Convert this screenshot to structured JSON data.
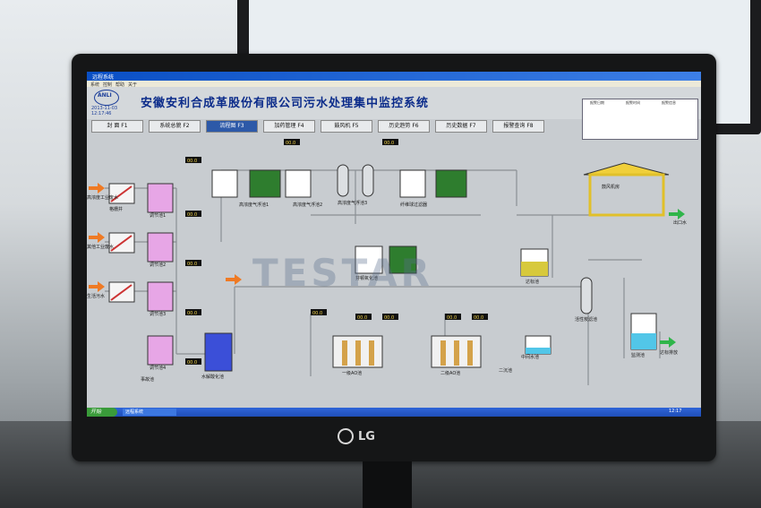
{
  "window": {
    "title": "远程系统",
    "menu": [
      "系统",
      "控制",
      "帮助",
      "关于"
    ]
  },
  "header": {
    "logo_text": "ANLI",
    "logo_caption": "安利",
    "date": "2013-11-03",
    "time": "12:17:46",
    "title": "安徽安利合成革股份有限公司污水处理集中监控系统",
    "info_columns": [
      "报警日期",
      "报警时间",
      "报警信息"
    ]
  },
  "tabs": [
    {
      "label": "封 面",
      "key": "F1"
    },
    {
      "label": "系统总貌",
      "key": "F2"
    },
    {
      "label": "流程图",
      "key": "F3",
      "active": true
    },
    {
      "label": "加药管理",
      "key": "F4"
    },
    {
      "label": "鼓风机",
      "key": "F5"
    },
    {
      "label": "历史趋势",
      "key": "F6"
    },
    {
      "label": "历史数据",
      "key": "F7"
    },
    {
      "label": "报警查询",
      "key": "F8"
    }
  ],
  "process": {
    "readout": "00.0",
    "inlets": [
      "高浓度工业废水",
      "其他工业废水",
      "生活污水"
    ],
    "units": [
      "格栅井",
      "调节池1",
      "调节池2",
      "调节池3",
      "调节池4",
      "事故池",
      "水解酸化池",
      "高浓度气浮池1",
      "高浓度气浮池2",
      "高浓度气浮池3",
      "纤维球过滤器",
      "芬顿氧化池",
      "中间水池",
      "二沉池",
      "达标池",
      "监测池",
      "活性炭滤池",
      "一级AO池",
      "二级AO池",
      "鼓风机房"
    ],
    "outlets": [
      "出口水",
      "达标排放"
    ]
  },
  "taskbar": {
    "start_label": "开始",
    "task_item": "远程系统",
    "clock": "12:17"
  },
  "watermark": "TESTAR",
  "monitor_brand": "LG"
}
